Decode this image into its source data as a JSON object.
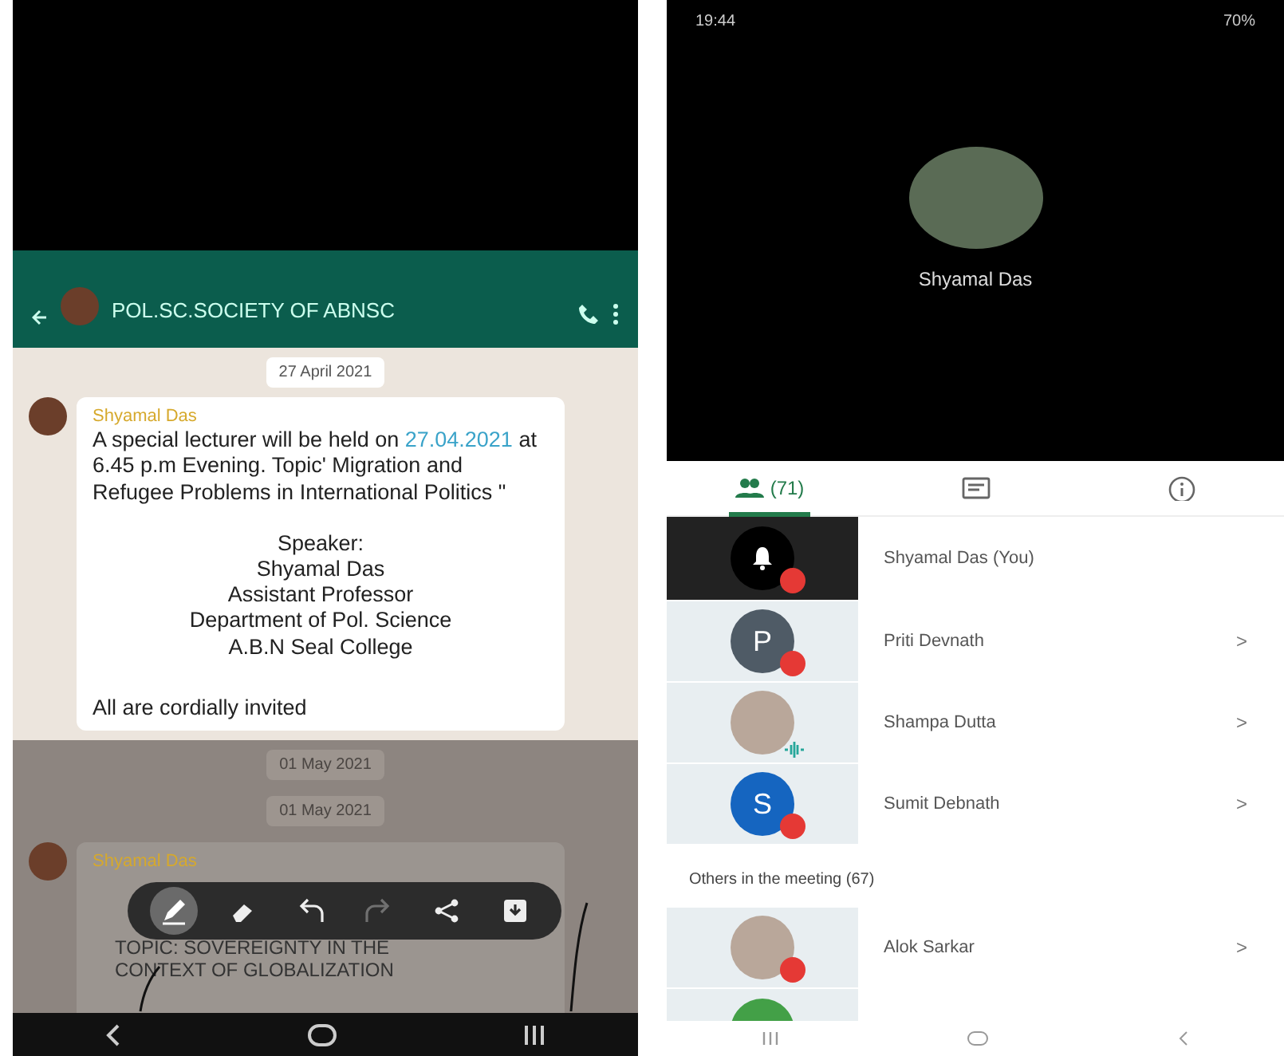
{
  "chat_screen": {
    "group_title": "POL.SC.SOCIETY OF ABNSC",
    "messages": [
      {
        "kind": "date",
        "text": "27 April 2021"
      },
      {
        "kind": "message",
        "sender": "Shyamal Das",
        "before": "A special lecturer will be held on",
        "link": "27.04.2021",
        "after": "at 6.45 p.m Evening. Topic' Migration and Refugee Problems in International Politics \"",
        "centered": [
          "Speaker:",
          "Shyamal Das",
          "Assistant Professor",
          "Department of Pol. Science",
          "A.B.N Seal College"
        ],
        "closing": "All are cordially invited"
      },
      {
        "kind": "date",
        "text": "01 May 2021"
      },
      {
        "kind": "date",
        "text": "01 May 2021"
      },
      {
        "kind": "partial",
        "sender": "Shyamal Das",
        "body": "TOPIC: SOVEREIGNTY IN THE CONTEXT OF GLOBALIZATION"
      }
    ],
    "toolbar": [
      {
        "kind": "pen",
        "selected": true,
        "disabled": false
      },
      {
        "kind": "eraser",
        "selected": false,
        "disabled": false
      },
      {
        "kind": "undo",
        "selected": false,
        "disabled": false
      },
      {
        "kind": "redo",
        "selected": false,
        "disabled": true
      },
      {
        "kind": "share",
        "selected": false,
        "disabled": false
      },
      {
        "kind": "save",
        "selected": false,
        "disabled": false
      }
    ]
  },
  "meeting_screen": {
    "status_time": "19:44",
    "battery": "70%",
    "presenter": "Shyamal Das",
    "tabs": [
      {
        "kind": "people",
        "label": "(71)",
        "selected": true
      },
      {
        "kind": "chat",
        "selected": false
      },
      {
        "kind": "info",
        "selected": false
      }
    ],
    "participants": [
      {
        "kind": "hand",
        "name": "Shyamal Das (You)",
        "muted": true,
        "speaking": false,
        "highlighted": true
      },
      {
        "kind": "letter",
        "name": "Priti Devnath",
        "letter": "P",
        "color": "#4f5b66",
        "muted": true,
        "speaking": false,
        "highlighted": false,
        "chevron": ">"
      },
      {
        "kind": "photo",
        "name": "Shampa Dutta",
        "muted": false,
        "speaking": true,
        "highlighted": false,
        "chevron": ">"
      },
      {
        "kind": "letter",
        "name": "Sumit Debnath",
        "letter": "S",
        "color": "#1565c0",
        "muted": true,
        "speaking": false,
        "highlighted": false,
        "chevron": ">"
      }
    ],
    "others_label": "Others in the meeting (67)",
    "others": [
      {
        "kind": "photo",
        "name": "Alok Sarkar",
        "muted": true,
        "speaking": false,
        "highlighted": false,
        "chevron": ">"
      }
    ]
  }
}
